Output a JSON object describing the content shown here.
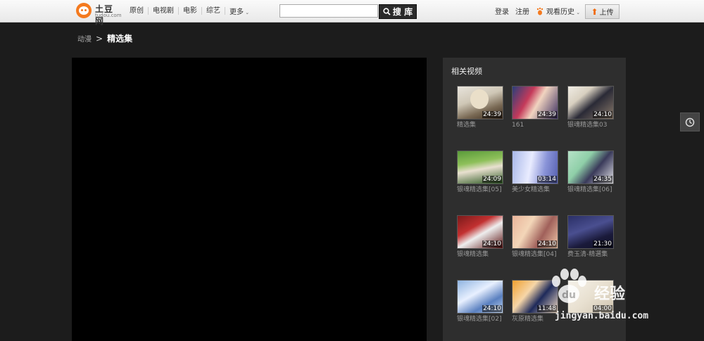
{
  "header": {
    "logo_title": "土豆网",
    "logo_sub": "tudou.com",
    "nav": [
      "原创",
      "电视剧",
      "电影",
      "综艺"
    ],
    "nav_more": "更多",
    "search_placeholder": "",
    "search_button": "搜 库",
    "login": "登录",
    "register": "注册",
    "history": "观看历史",
    "upload": "上传"
  },
  "breadcrumb": {
    "parent": "动漫",
    "current": "精选集"
  },
  "related": {
    "title": "相关视频",
    "items": [
      {
        "title": "精选集",
        "duration": "24:39"
      },
      {
        "title": "161",
        "duration": "24:39"
      },
      {
        "title": "银魂精选集03",
        "duration": "24:10"
      },
      {
        "title": "银魂精选集[05]",
        "duration": "24:09"
      },
      {
        "title": "美少女精选集",
        "duration": "03:14"
      },
      {
        "title": "银魂精选集[06]",
        "duration": "24:35"
      },
      {
        "title": "银魂精选集",
        "duration": "24:10"
      },
      {
        "title": "银魂精选集[04]",
        "duration": "24:10"
      },
      {
        "title": "费玉清-精選集",
        "duration": "21:30"
      },
      {
        "title": "银魂精选集[02]",
        "duration": "24:10"
      },
      {
        "title": "灰原精选集",
        "duration": "11:48"
      },
      {
        "title": "",
        "duration": "04:00"
      }
    ]
  },
  "watermark": {
    "brand": "经验",
    "url": "jingyan.baidu.com"
  },
  "colors": {
    "logo_orange": "#f47a1f",
    "upload_arrow": "#f06b0f"
  }
}
